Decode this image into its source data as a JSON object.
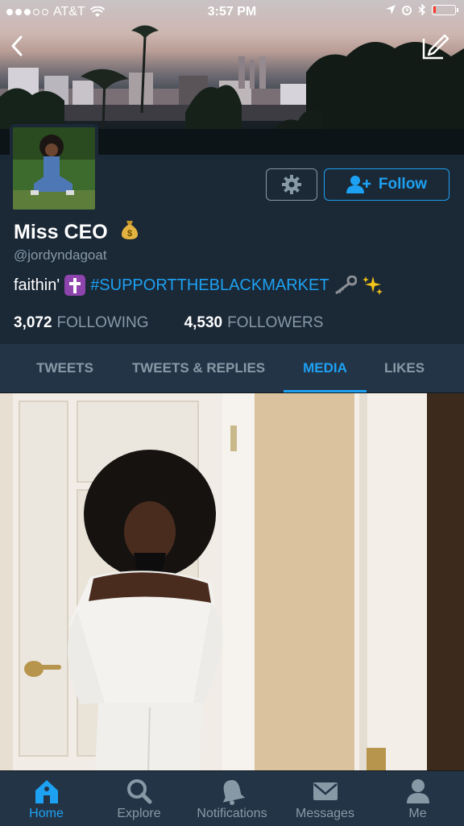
{
  "status_bar": {
    "carrier": "AT&T",
    "time": "3:57 PM",
    "battery_level": 0.1
  },
  "header": {
    "back_icon": "chevron-left-icon",
    "compose_icon": "compose-icon"
  },
  "profile": {
    "name": "Miss CEO",
    "name_emoji": "money-bag-icon",
    "handle": "@jordyndagoat",
    "bio_text": "faithin'",
    "bio_emoji_1": "latin-cross-icon",
    "bio_hashtag": "#SUPPORTTHEBLACKMARKET",
    "bio_emoji_2": "key-icon",
    "bio_emoji_3": "sparkles-icon",
    "following_count": "3,072",
    "following_label": "FOLLOWING",
    "followers_count": "4,530",
    "followers_label": "FOLLOWERS"
  },
  "actions": {
    "settings_icon": "gear-icon",
    "follow_label": "Follow",
    "follow_icon": "add-user-icon"
  },
  "tabs": [
    {
      "label": "TWEETS",
      "active": false
    },
    {
      "label": "TWEETS & REPLIES",
      "active": false
    },
    {
      "label": "MEDIA",
      "active": true
    },
    {
      "label": "LIKES",
      "active": false
    }
  ],
  "bottom_nav": [
    {
      "label": "Home",
      "icon": "home-icon",
      "active": true
    },
    {
      "label": "Explore",
      "icon": "search-icon",
      "active": false
    },
    {
      "label": "Notifications",
      "icon": "bell-icon",
      "active": false
    },
    {
      "label": "Messages",
      "icon": "envelope-icon",
      "active": false
    },
    {
      "label": "Me",
      "icon": "person-icon",
      "active": false
    }
  ],
  "colors": {
    "accent": "#1da1f2",
    "background": "#1b2836",
    "bar_background": "#243447",
    "muted_text": "#8899a6"
  }
}
